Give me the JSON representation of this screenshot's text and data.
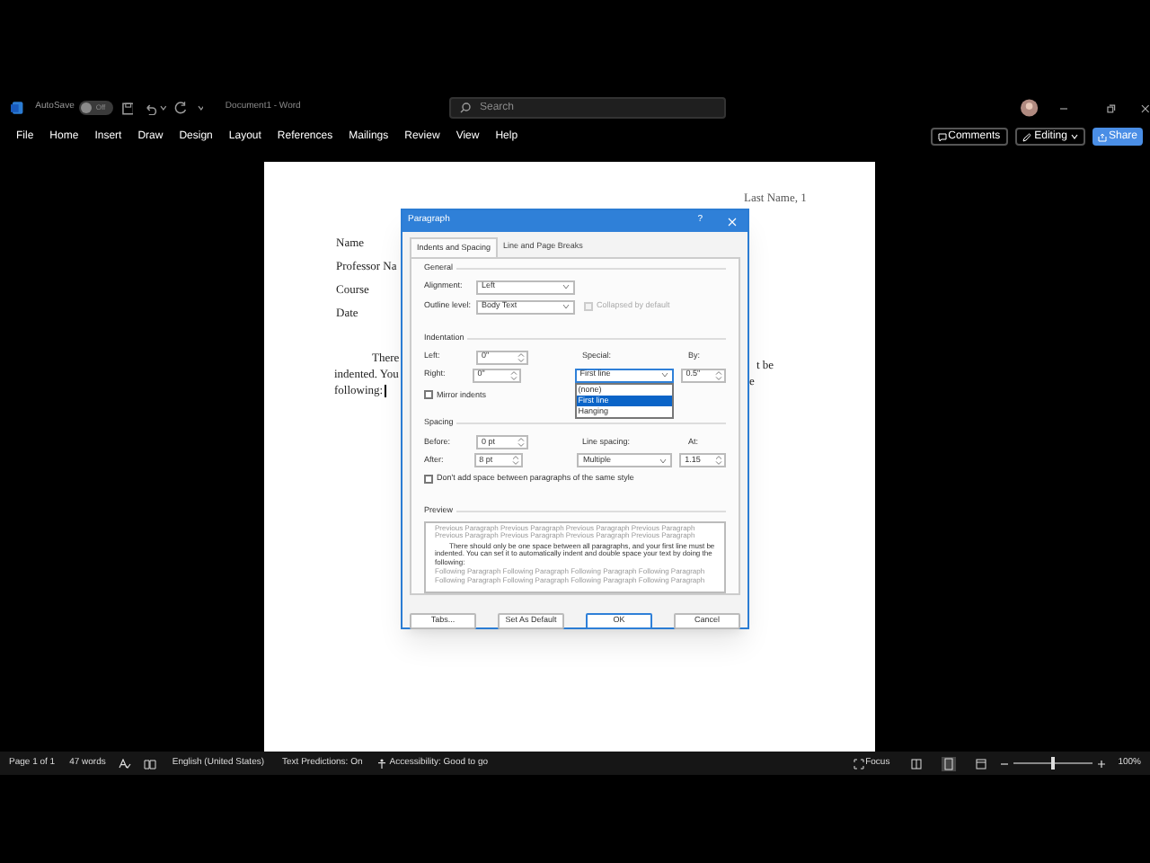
{
  "title_bar": {
    "autosave_label": "AutoSave",
    "autosave": {
      "on": false,
      "label": "Off"
    },
    "document_title": "Document1 - Word",
    "search": {
      "placeholder": "Search"
    }
  },
  "ribbon_tabs": [
    "File",
    "Home",
    "Insert",
    "Draw",
    "Design",
    "Layout",
    "References",
    "Mailings",
    "Review",
    "View",
    "Help"
  ],
  "ribbon_actions": [
    {
      "label": "Comments",
      "kind": "comments"
    },
    {
      "label": "Editing",
      "kind": "editing"
    },
    {
      "label": "Share",
      "kind": "share"
    }
  ],
  "document": {
    "header": "Last Name, 1",
    "lines": [
      "Name",
      "Professor Na",
      "Course",
      "Date"
    ],
    "paragraph": [
      "There",
      "indented. You",
      "following:"
    ],
    "right_fragments": [
      "t be",
      "e"
    ]
  },
  "dialog": {
    "title": "Paragraph",
    "help": "?",
    "tabs": [
      {
        "label": "Indents and Spacing",
        "selected": true
      },
      {
        "label": "Line and Page Breaks",
        "selected": false
      }
    ],
    "general": {
      "heading": "General",
      "alignment": {
        "label": "Alignment:",
        "value": "Left"
      },
      "outline_level": {
        "label": "Outline level:",
        "value": "Body Text"
      },
      "collapsed": {
        "label": "Collapsed by default",
        "checked": false,
        "disabled": true
      }
    },
    "indentation": {
      "heading": "Indentation",
      "left": {
        "label": "Left:",
        "value": "0\""
      },
      "right": {
        "label": "Right:",
        "value": "0\""
      },
      "special": {
        "label": "Special:",
        "value": "First line",
        "expanded": true,
        "options": [
          {
            "label": "(none)",
            "selected": false
          },
          {
            "label": "First line",
            "selected": true
          },
          {
            "label": "Hanging",
            "selected": false
          }
        ]
      },
      "by": {
        "label": "By:",
        "value": "0.5\""
      },
      "mirror": {
        "label": "Mirror indents",
        "checked": false
      }
    },
    "spacing": {
      "heading": "Spacing",
      "before": {
        "label": "Before:",
        "value": "0 pt"
      },
      "after": {
        "label": "After:",
        "value": "8 pt"
      },
      "line_spacing": {
        "label": "Line spacing:",
        "value": "Multiple"
      },
      "at": {
        "label": "At:",
        "value": "1.15"
      },
      "dont_add": {
        "label": "Don't add space between paragraphs of the same style",
        "checked": false
      }
    },
    "preview": {
      "heading": "Preview",
      "previous": "Previous Paragraph Previous Paragraph Previous Paragraph Previous Paragraph Previous Paragraph Previous Paragraph Previous Paragraph Previous Paragraph",
      "sample": "There should only be one space between all paragraphs, and your first line must be indented. You can set it to automatically indent and double space your text by doing the following:",
      "following": "Following Paragraph Following Paragraph Following Paragraph Following Paragraph Following Paragraph Following Paragraph Following Paragraph Following Paragraph"
    },
    "buttons": [
      {
        "label": "Tabs...",
        "primary": false
      },
      {
        "label": "Set As Default",
        "primary": false
      },
      {
        "label": "OK",
        "primary": true
      },
      {
        "label": "Cancel",
        "primary": false
      }
    ]
  },
  "status_bar": {
    "page": "Page 1 of 1",
    "words": "47 words",
    "language": "English (United States)",
    "predictions": "Text Predictions: On",
    "accessibility": "Accessibility: Good to go",
    "focus": "Focus",
    "zoom": {
      "level": 0.48
    },
    "zoom_percent": "100%"
  }
}
